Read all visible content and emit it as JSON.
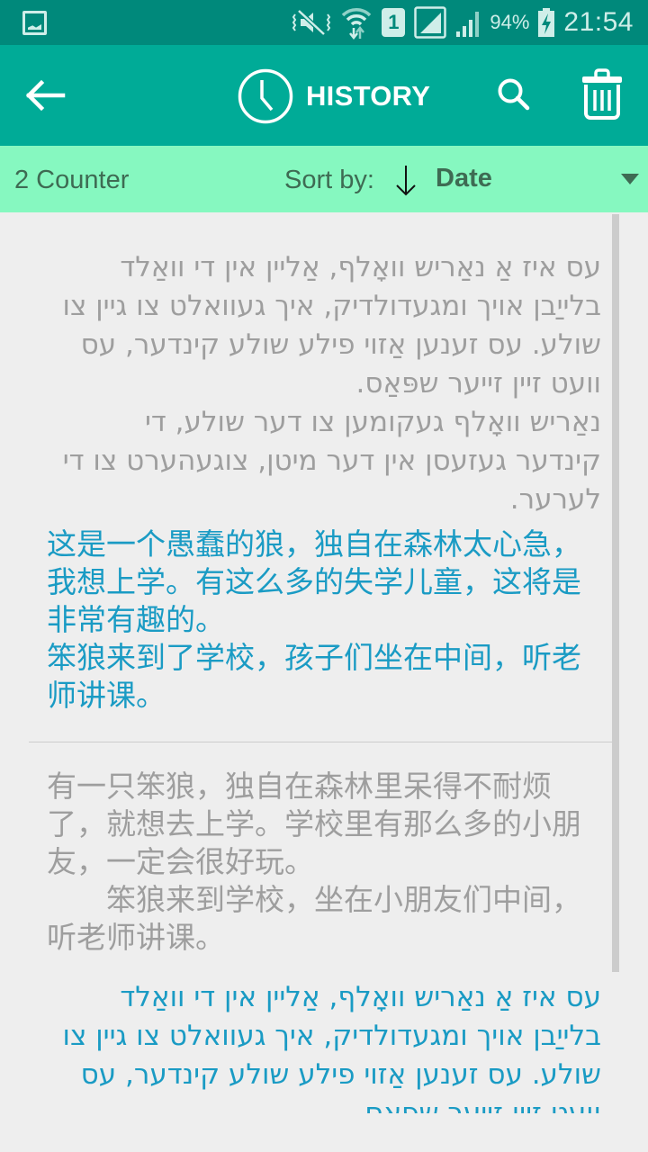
{
  "status_bar": {
    "time": "21:54",
    "battery_percent": "94%",
    "sim_slot": "1",
    "icons": [
      "gallery-notification-icon",
      "vibrate-mute-icon",
      "wifi-icon",
      "sim-1-icon",
      "signal-icon",
      "signal-icon",
      "battery-charging-icon"
    ]
  },
  "app_bar": {
    "title": "HISTORY",
    "icons": {
      "back": "arrow-left-icon",
      "title": "clock-icon",
      "search": "search-icon",
      "delete": "trash-icon"
    }
  },
  "sort_bar": {
    "counter": "2 Counter",
    "sort_label": "Sort by:",
    "sort_direction": "descending",
    "sort_value": "Date"
  },
  "colors": {
    "status_bar": "#00897b",
    "app_bar": "#00ab97",
    "sort_bar": "#86f8c0",
    "sort_text": "#3e6b53",
    "source_text": "#9e9e9e",
    "translated_text": "#1a9bc4",
    "background": "#eeeeee"
  },
  "history": [
    {
      "source_text": "עס איז אַ נאַריש וואָלף, אַליין אין די וואַלד בלייַבן אויך ומגעדולדיק, איך געוואלט צו גיין צו שולע. עס זענען אַזוי פילע שולע קינדער, עס וועט זיין זייער שפּאַס.\nנאַריש וואָלף געקומען צו דער שולע, די קינדער געזעסן אין דער מיטן, צוגעהערט צו די לערער.",
      "translated_text": "这是一个愚蠢的狼，独自在森林太心急，我想上学。有这么多的失学儿童，这将是非常有趣的。\n笨狼来到了学校，孩子们坐在中间，听老师讲课。"
    },
    {
      "source_text": "有一只笨狼，独自在森林里呆得不耐烦了，就想去上学。学校里有那么多的小朋友，一定会很好玩。\n　　笨狼来到学校，坐在小朋友们中间，听老师讲课。",
      "translated_text": "עס איז אַ נאַריש וואָלף, אַליין אין די וואַלד בלייַבן אויך ומגעדולדיק, איך געוואלט צו גיין צו שולע. עס זענען אַזוי פילע שולע קינדער, עס וועט זיין זייער שפּאַס."
    }
  ]
}
